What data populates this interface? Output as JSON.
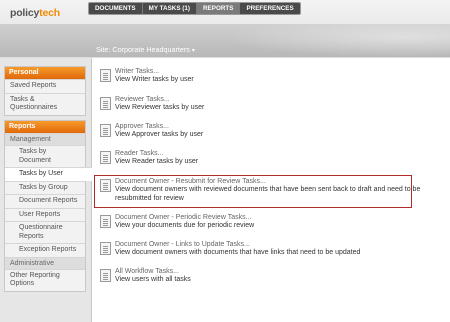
{
  "logo": {
    "part1": "policy",
    "part2": "tech"
  },
  "topnav": {
    "documents": "DOCUMENTS",
    "my_tasks": "MY TASKS (1)",
    "reports": "REPORTS",
    "preferences": "PREFERENCES"
  },
  "site": {
    "label": "Site: Corporate Headquarters",
    "caret": "▾"
  },
  "sidebar": {
    "personal": {
      "header": "Personal",
      "items": [
        "Saved Reports",
        "Tasks & Questionnaires"
      ]
    },
    "reports": {
      "header": "Reports",
      "management": "Management",
      "sub_items": [
        "Tasks by Document",
        "Tasks by User",
        "Tasks by Group",
        "Document Reports",
        "User Reports",
        "Questionnaire Reports",
        "Exception Reports"
      ],
      "administrative": "Administrative",
      "other": "Other Reporting Options"
    }
  },
  "tasks": [
    {
      "title": "Writer Tasks...",
      "desc": "View Writer tasks by user"
    },
    {
      "title": "Reviewer Tasks...",
      "desc": "View Reviewer tasks by user"
    },
    {
      "title": "Approver Tasks...",
      "desc": "View Approver tasks by user"
    },
    {
      "title": "Reader Tasks...",
      "desc": "View Reader tasks by user"
    },
    {
      "title": "Document Owner - Resubmit for Review Tasks...",
      "desc": "View document owners with reviewed documents that have been sent back to draft and need to be resubmitted for review"
    },
    {
      "title": "Document Owner - Periodic Review Tasks...",
      "desc": "View your documents due for periodic review"
    },
    {
      "title": "Document Owner - Links to Update Tasks...",
      "desc": "View document owners with documents that have links that need to be updated"
    },
    {
      "title": "All Workflow Tasks...",
      "desc": "View users with all tasks"
    }
  ]
}
